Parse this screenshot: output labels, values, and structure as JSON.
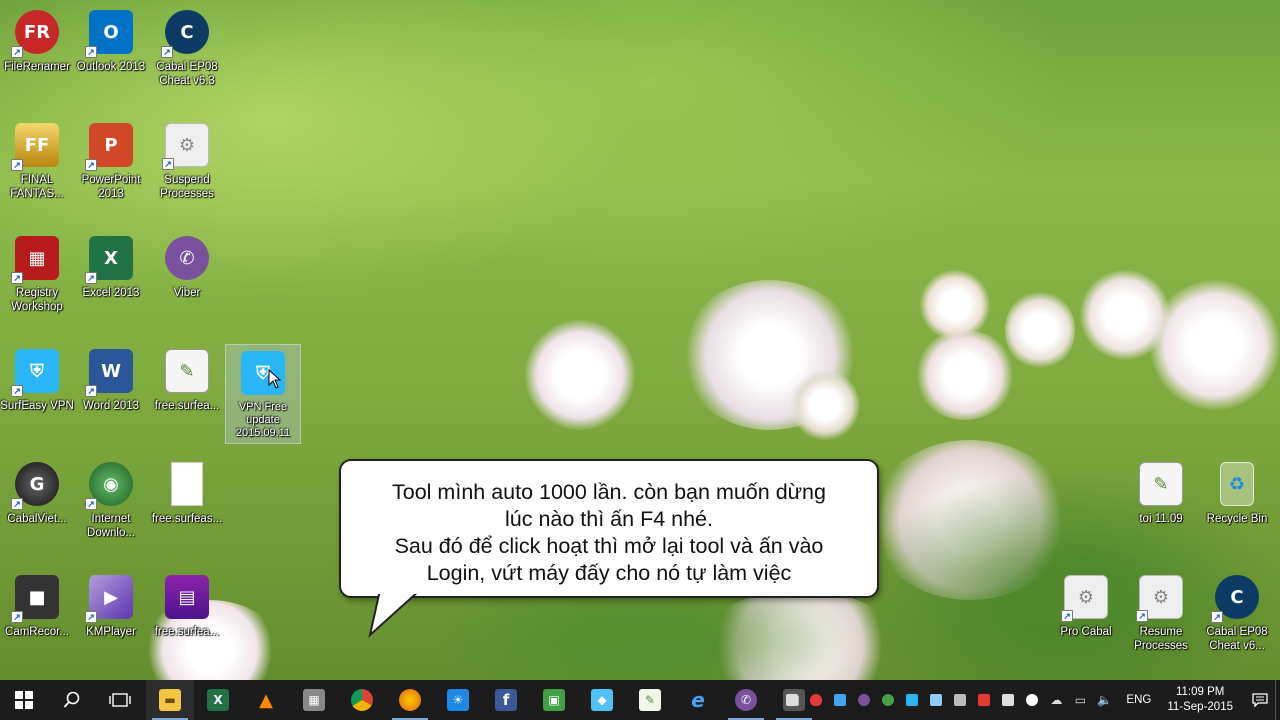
{
  "desktop_icons": {
    "filerenamer": {
      "label": "FileRenamer",
      "icon": "filerenamer-icon",
      "text": "FR",
      "color": "#c62828"
    },
    "outlook": {
      "label": "Outlook 2013",
      "icon": "outlook-icon",
      "text": "O",
      "color": "#0072c6"
    },
    "cabal_ep08_1": {
      "label": "Cabal EP08 Cheat v6.3",
      "icon": "cheat-engine-icon",
      "text": "C",
      "color": "#0d3b66"
    },
    "final_fantasy": {
      "label": "FINAL FANTAS...",
      "icon": "final-fantasy-icon",
      "text": "FF",
      "color": "#b8860b"
    },
    "powerpoint": {
      "label": "PowerPoint 2013",
      "icon": "powerpoint-icon",
      "text": "P",
      "color": "#d24726"
    },
    "suspend_processes": {
      "label": "Suspend Processes",
      "icon": "gear-script-icon",
      "text": "⚙",
      "color": "#e8e8e8"
    },
    "registry_workshop": {
      "label": "Registry Workshop",
      "icon": "registry-workshop-icon",
      "text": "▦",
      "color": "#b71c1c"
    },
    "excel": {
      "label": "Excel 2013",
      "icon": "excel-icon",
      "text": "X",
      "color": "#217346"
    },
    "viber": {
      "label": "Viber",
      "icon": "viber-icon",
      "text": "✆",
      "color": "#7b519d"
    },
    "surfeasy": {
      "label": "SurfEasy VPN",
      "icon": "surfeasy-shield-icon",
      "text": "⛨",
      "color": "#29b6f6"
    },
    "word": {
      "label": "Word 2013",
      "icon": "word-icon",
      "text": "W",
      "color": "#2b579a"
    },
    "free_surfeasy_notepad": {
      "label": "free.surfea...",
      "icon": "notepad-plus-icon",
      "text": "✎",
      "color": "#9ccc65"
    },
    "vpn_free_update": {
      "label": "VPN Free update 2015.09.11",
      "icon": "surfeasy-shield-icon",
      "text": "⛨",
      "color": "#29b6f6"
    },
    "cabalviet": {
      "label": "CabalViet...",
      "icon": "cabal-icon",
      "text": "G",
      "color": "#333333"
    },
    "internet_download": {
      "label": "Internet Downlo...",
      "icon": "idm-globe-icon",
      "text": "◉",
      "color": "#2e7d32"
    },
    "free_surfeas_blank": {
      "label": "free.surfeas...",
      "icon": "blank-file-icon",
      "text": "",
      "color": "#ffffff"
    },
    "camrecorder": {
      "label": "CamRecor...",
      "icon": "camcorder-icon",
      "text": "■",
      "color": "#333333"
    },
    "kmplayer": {
      "label": "KMPlayer",
      "icon": "kmplayer-icon",
      "text": "▶",
      "color": "#8e7cc3"
    },
    "free_surfeas_rar": {
      "label": "free.surfea...",
      "icon": "winrar-icon",
      "text": "▤",
      "color": "#6a1b9a"
    },
    "toi_1109": {
      "label": "toi 11.09",
      "icon": "notepad-plus-icon",
      "text": "✎",
      "color": "#9ccc65"
    },
    "recycle_bin": {
      "label": "Recycle Bin",
      "icon": "recycle-bin-icon",
      "text": "♻",
      "color": "#90caf9"
    },
    "pro_cabal": {
      "label": "Pro Cabal",
      "icon": "gear-script-icon",
      "text": "⚙",
      "color": "#e8e8e8"
    },
    "resume_processes": {
      "label": "Resume Processes",
      "icon": "gear-script-icon",
      "text": "⚙",
      "color": "#e8e8e8"
    },
    "cabal_ep08_2": {
      "label": "Cabal EP08 Cheat v6...",
      "icon": "cheat-engine-icon",
      "text": "C",
      "color": "#0d3b66"
    }
  },
  "callout": {
    "line1": "Tool mình auto 1000 lần. còn bạn muốn dừng",
    "line2": "lúc nào thì ấn F4 nhé.",
    "line3": "Sau đó để click hoạt thì mở lại tool và ấn vào",
    "line4": "Login, vứt máy đấy cho nó tự làm việc"
  },
  "taskbar": {
    "start_icon": "windows-logo-icon",
    "search_icon": "search-icon",
    "task_view_icon": "task-view-icon",
    "apps": [
      {
        "name": "file-explorer-icon",
        "text": "▬",
        "color": "#f4c542",
        "running": true
      },
      {
        "name": "excel-icon",
        "text": "X",
        "color": "#217346",
        "running": false
      },
      {
        "name": "vlc-icon",
        "text": "▲",
        "color": "#ff8800",
        "running": false
      },
      {
        "name": "film-clapper-icon",
        "text": "▦",
        "color": "#888888",
        "running": false
      },
      {
        "name": "chrome-icon",
        "text": "◉",
        "color": "#db4437",
        "running": false
      },
      {
        "name": "firefox-icon",
        "text": "◉",
        "color": "#e66000",
        "running": true
      },
      {
        "name": "brightness-icon",
        "text": "☀",
        "color": "#1e88e5",
        "running": false
      },
      {
        "name": "facebook-icon",
        "text": "f",
        "color": "#3b5998",
        "running": false
      },
      {
        "name": "app-green-icon",
        "text": "▣",
        "color": "#43a047",
        "running": false
      },
      {
        "name": "app-blue-icon",
        "text": "◆",
        "color": "#4fc3f7",
        "running": false
      },
      {
        "name": "notepad-plus-icon",
        "text": "✎",
        "color": "#9ccc65",
        "running": false
      },
      {
        "name": "internet-explorer-icon",
        "text": "e",
        "color": "#1e88e5",
        "running": false
      },
      {
        "name": "viber-icon",
        "text": "✆",
        "color": "#7b519d",
        "running": true
      },
      {
        "name": "camcorder-icon",
        "text": "■",
        "color": "#555555",
        "running": true
      }
    ],
    "tray": [
      {
        "name": "tray-app-icon-1",
        "color": "#dddddd"
      },
      {
        "name": "tray-shield-icon",
        "color": "#e53935"
      },
      {
        "name": "tray-app-icon-2",
        "color": "#42a5f5"
      },
      {
        "name": "tray-viber-icon",
        "color": "#7b519d"
      },
      {
        "name": "tray-green-icon",
        "color": "#43a047"
      },
      {
        "name": "tray-vpn-icon",
        "color": "#29b6f6"
      },
      {
        "name": "tray-doc-icon",
        "color": "#90caf9"
      },
      {
        "name": "tray-tool-icon",
        "color": "#bbbbbb"
      },
      {
        "name": "tray-red-icon",
        "color": "#e53935"
      },
      {
        "name": "tray-keyboard-icon",
        "color": "#dddddd"
      },
      {
        "name": "tray-cloud-icon",
        "color": "#ffffff"
      },
      {
        "name": "tray-onedrive-icon",
        "color": "#ffffff"
      },
      {
        "name": "tray-network-icon",
        "color": "#ffffff"
      },
      {
        "name": "tray-volume-icon",
        "color": "#ffffff"
      }
    ],
    "language": "ENG",
    "time": "11:09 PM",
    "date": "11-Sep-2015",
    "notification_icon": "action-center-icon"
  }
}
